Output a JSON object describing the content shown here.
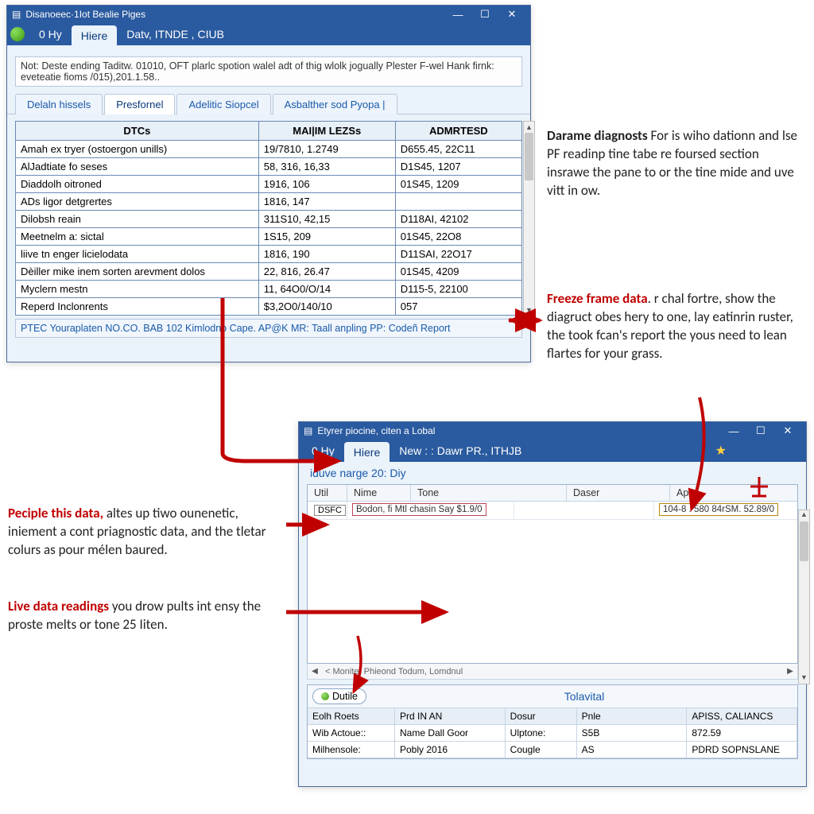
{
  "window1": {
    "title": "Disanoeec·1Iot Bealie Piges",
    "menu": {
      "ohy": "0 Hy",
      "hiere": "Hiere",
      "datv": "Datv, ITNDE , CIUB"
    },
    "note": "Not: Deste ending Taditw. 01010, OFT plarlc spotion walel adt of thig wlolk jogually Plester F-wel Hank firnk: eveteatie fioms /015),201.1.58..",
    "tabs": [
      "Delaln hissels",
      "Presfornel",
      "Adelitic Siopcel",
      "Asbalther sod Pyopa |"
    ],
    "columns": [
      "DTCs",
      "MAI|IM LEZSs",
      "ADMRTESD"
    ],
    "rows": [
      [
        "Amah ex tryer (ostoergon unills)",
        "19/7810, 1.2749",
        "D655.45, 22C11"
      ],
      [
        "AlJadtiate fo seses",
        "58, 316, 16,33",
        "D1S45, 1207"
      ],
      [
        "Diaddolh oitroned",
        "1916, 106",
        "01S45, 1209"
      ],
      [
        "ADs ligor detgrertes",
        "1816, 147",
        ""
      ],
      [
        "Dilobsh reain",
        "311S10, 42,15",
        "D118AI, 42102"
      ],
      [
        "Meetnelm a: sictal",
        "1S15, 209",
        "01S45, 22O8"
      ],
      [
        "liive tn enger licielodata",
        "1816, 190",
        "D11SAI, 22O17"
      ],
      [
        "Dèiller mike inem sorten arevment dolos",
        "22, 816, 26.47",
        "01S45, 4209"
      ],
      [
        "Myclern mestn",
        "11, 64O0/O/14",
        "D115-5, 22100"
      ],
      [
        "Reperd Inclonrents",
        "$3,2O0/140/10",
        "057"
      ]
    ],
    "status": "PTEC Youraplaten NO.CO. BAB 102 Kimlodno Cape. AP@K MR: Taall anpling PP: Codeñ Report"
  },
  "window2": {
    "title": "Etyrer piocine, citen a Lobal",
    "menu": {
      "ohy": "0 Hy",
      "hiere": "Hiere",
      "new": "New : : Dawr PR., ITHJB"
    },
    "sub": "iduve narge 20: Diy",
    "cols": {
      "util": "Util",
      "nime": "Nime",
      "tone": "Tone",
      "daser": "Daser",
      "ap": "Ap"
    },
    "row": {
      "dsfc": "DSFC",
      "nime": "Bodon, fi Mtl chasin Say $1.9/0",
      "ap": "104-8 . 580 84rSM. 52.89/0"
    },
    "hsbar": "< Monite:   Phieond Todum, Lomdnul",
    "button": "Dutile",
    "totlabel": "Tolavital",
    "kv": {
      "r1": [
        "Eolh Roets",
        "Prd IN AN",
        "Dosur",
        "Pnle",
        "APISS, CALIANCS"
      ],
      "r2": [
        "Wib Actoue::",
        "Name Dall Goor",
        "Ulptone:",
        "S5B",
        "872.59"
      ],
      "r3": [
        "Milhensole:",
        "Pobly 2016",
        "Cougle",
        "AS",
        "PDRD SOPNSLANE"
      ]
    }
  },
  "annotations": {
    "a1_bold": "Darame diagnosts",
    "a1_rest": " For is wiho dationn and lse PF readinp tine tabe re foursed section insrawe the pane to or the tine mide and uve vitt in ow.",
    "a2_red": "Freeze frame data",
    "a2_rest": ". r chal fortre, show the diagruct obes hery to one, lay eatinrin ruster, the took fcan's report the yous need to lean flartes for your grass.",
    "a3_red": "Peciple this data,",
    "a3_rest": " altes up tiwo ounenetic, iniement a cont priagnostic data, and the tletar colurs as pour mélen baured.",
    "a4_red": "Live data readings",
    "a4_rest": " you drow pults int ensy the proste melts or tone 25 Iiten."
  }
}
